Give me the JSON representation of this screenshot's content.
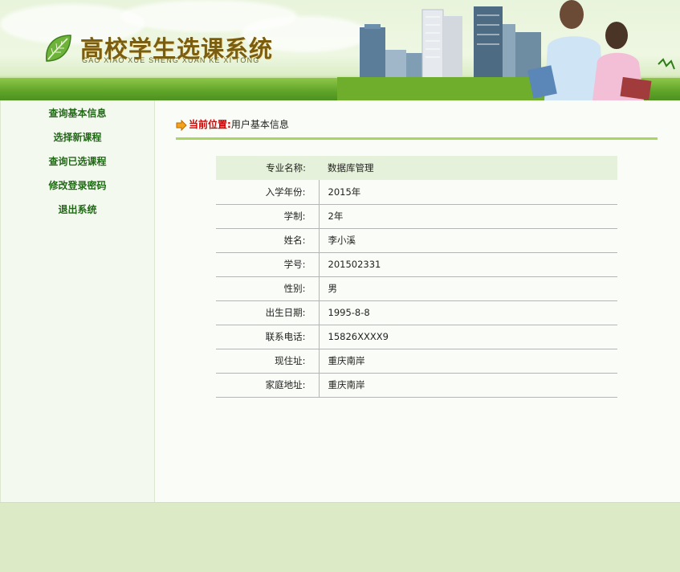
{
  "header": {
    "title": "高校学生选课系统",
    "subtitle": "GAO XIAO XUE SHENG XUAN KE XI TONG"
  },
  "sidebar": {
    "items": [
      {
        "label": "查询基本信息"
      },
      {
        "label": "选择新课程"
      },
      {
        "label": "查询已选课程"
      },
      {
        "label": "修改登录密码"
      },
      {
        "label": "退出系统"
      }
    ]
  },
  "breadcrumb": {
    "label": "当前位置:",
    "value": "用户基本信息"
  },
  "info": {
    "rows": [
      {
        "label": "专业名称:",
        "value": "数据库管理"
      },
      {
        "label": "入学年份:",
        "value": "2015年"
      },
      {
        "label": "学制:",
        "value": "2年"
      },
      {
        "label": "姓名:",
        "value": "李小溪"
      },
      {
        "label": "学号:",
        "value": "201502331"
      },
      {
        "label": "性别:",
        "value": "男"
      },
      {
        "label": "出生日期:",
        "value": "1995-8-8"
      },
      {
        "label": "联系电话:",
        "value": "15826XXXX9"
      },
      {
        "label": "现住址:",
        "value": "重庆南岸"
      },
      {
        "label": "家庭地址:",
        "value": "重庆南岸"
      }
    ]
  },
  "colors": {
    "nav_text": "#1f6b14",
    "crumb_label": "#d40000",
    "divider": "#a9d563",
    "header_row_bg": "#e5f1da",
    "footer_bg": "#dcebc6"
  }
}
